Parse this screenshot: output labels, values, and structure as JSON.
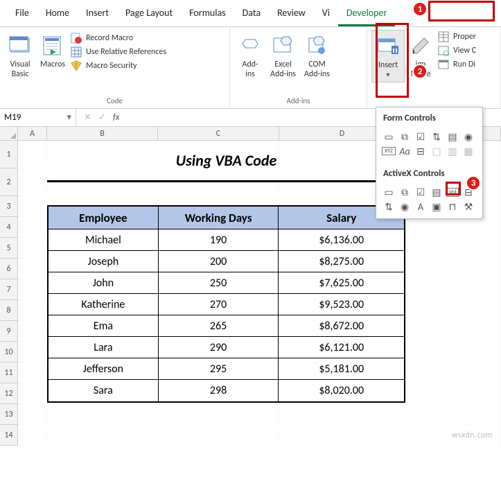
{
  "tabs": {
    "file": "File",
    "home": "Home",
    "insert": "Insert",
    "pageLayout": "Page Layout",
    "formulas": "Formulas",
    "data": "Data",
    "review": "Review",
    "view": "Vi",
    "developer": "Developer"
  },
  "ribbon": {
    "code": {
      "visualBasic": "Visual\nBasic",
      "macros": "Macros",
      "recordMacro": "Record Macro",
      "useRelative": "Use Relative References",
      "macroSecurity": "Macro Security",
      "label": "Code"
    },
    "addins": {
      "addins": "Add-\nins",
      "excelAddins": "Excel\nAdd-ins",
      "comAddins": "COM\nAdd-ins",
      "label": "Add-ins"
    },
    "controls": {
      "insert": "Insert",
      "designMode": "ign\nMode",
      "properties": "Proper",
      "viewCode": "View C",
      "runDialog": "Run Di"
    }
  },
  "namebox": {
    "value": "M19"
  },
  "dropdown": {
    "formHeader": "Form Controls",
    "activexHeader": "ActiveX Controls"
  },
  "sheet": {
    "colWidths": {
      "A": 42,
      "B": 160,
      "C": 175,
      "D": 182,
      "E": 120
    },
    "title": "Using VBA Code",
    "headers": {
      "emp": "Employee",
      "days": "Working Days",
      "sal": "Salary"
    },
    "rows": [
      {
        "emp": "Michael",
        "days": "190",
        "sal": "$6,136.00"
      },
      {
        "emp": "Joseph",
        "days": "200",
        "sal": "$8,275.00"
      },
      {
        "emp": "John",
        "days": "250",
        "sal": "$7,625.00"
      },
      {
        "emp": "Katherine",
        "days": "270",
        "sal": "$9,523.00"
      },
      {
        "emp": "Ema",
        "days": "265",
        "sal": "$8,672.00"
      },
      {
        "emp": "Lara",
        "days": "290",
        "sal": "$6,121.00"
      },
      {
        "emp": "Jefferson",
        "days": "295",
        "sal": "$5,181.00"
      },
      {
        "emp": "Sara",
        "days": "298",
        "sal": "$8,020.00"
      }
    ]
  },
  "callouts": {
    "c1": "1",
    "c2": "2",
    "c3": "3"
  },
  "watermark": "wsxdn.com"
}
